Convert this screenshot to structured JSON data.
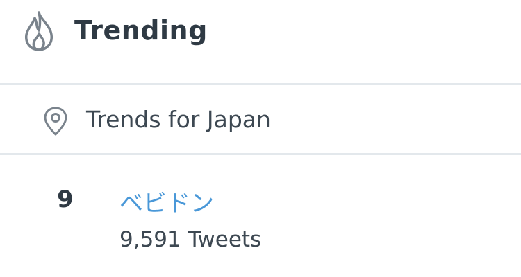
{
  "header": {
    "icon": "flame-icon",
    "title": "Trending"
  },
  "location": {
    "icon": "location-pin-icon",
    "label": "Trends for Japan"
  },
  "trends": [
    {
      "rank": "9",
      "name": "ベビドン",
      "count": "9,591 Tweets"
    }
  ],
  "colors": {
    "link": "#4a98d8",
    "text": "#2f3a44",
    "divider": "#e3e8ec"
  }
}
